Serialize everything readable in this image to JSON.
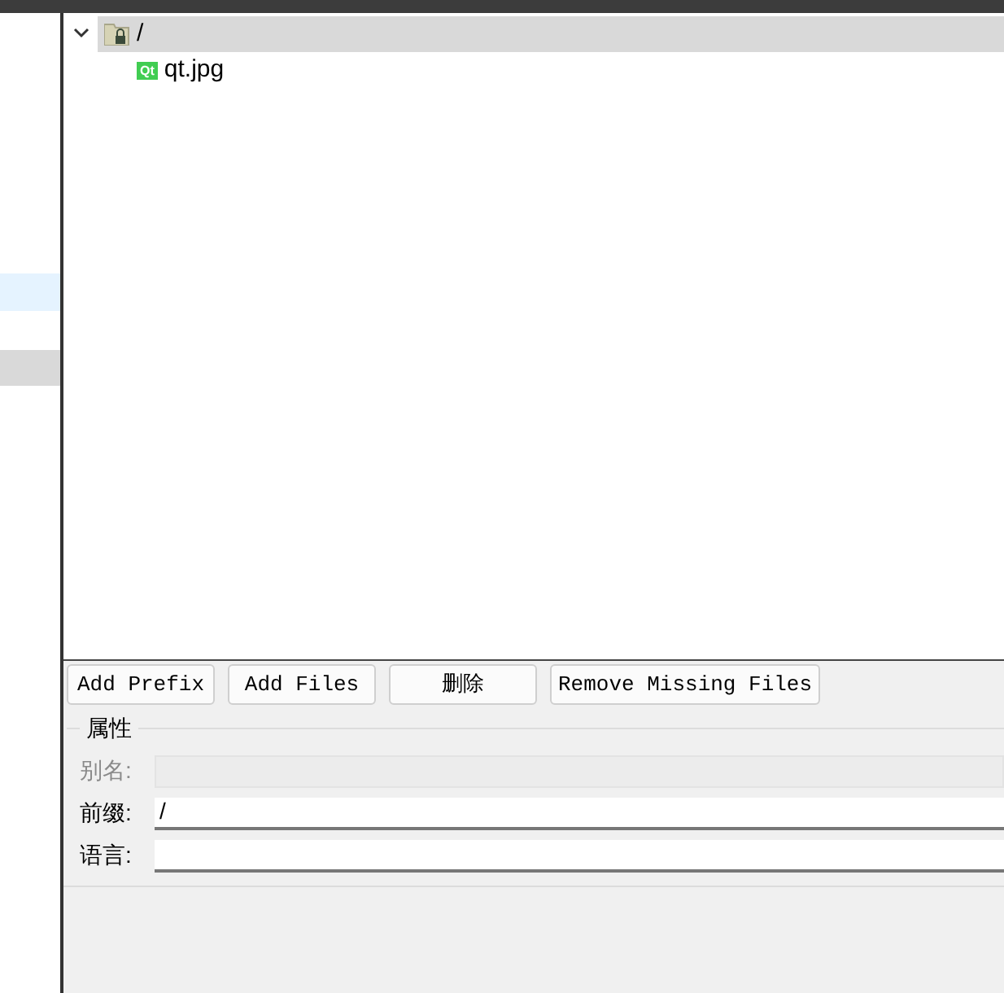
{
  "tree": [
    {
      "label": "/",
      "kind": "prefix",
      "expanded": true,
      "selected": true,
      "children": [
        {
          "label": "qt.jpg",
          "kind": "file",
          "badge": "Qt",
          "selected": false
        }
      ]
    }
  ],
  "buttons": [
    "Add Prefix",
    "Add Files",
    "删除",
    "Remove Missing Files"
  ],
  "properties": {
    "title": "属性",
    "fields": [
      {
        "label": "别名:",
        "disabled": true
      },
      {
        "label": "前缀:",
        "value": "/",
        "disabled": false
      },
      {
        "label": "语言:",
        "disabled": false
      }
    ]
  }
}
